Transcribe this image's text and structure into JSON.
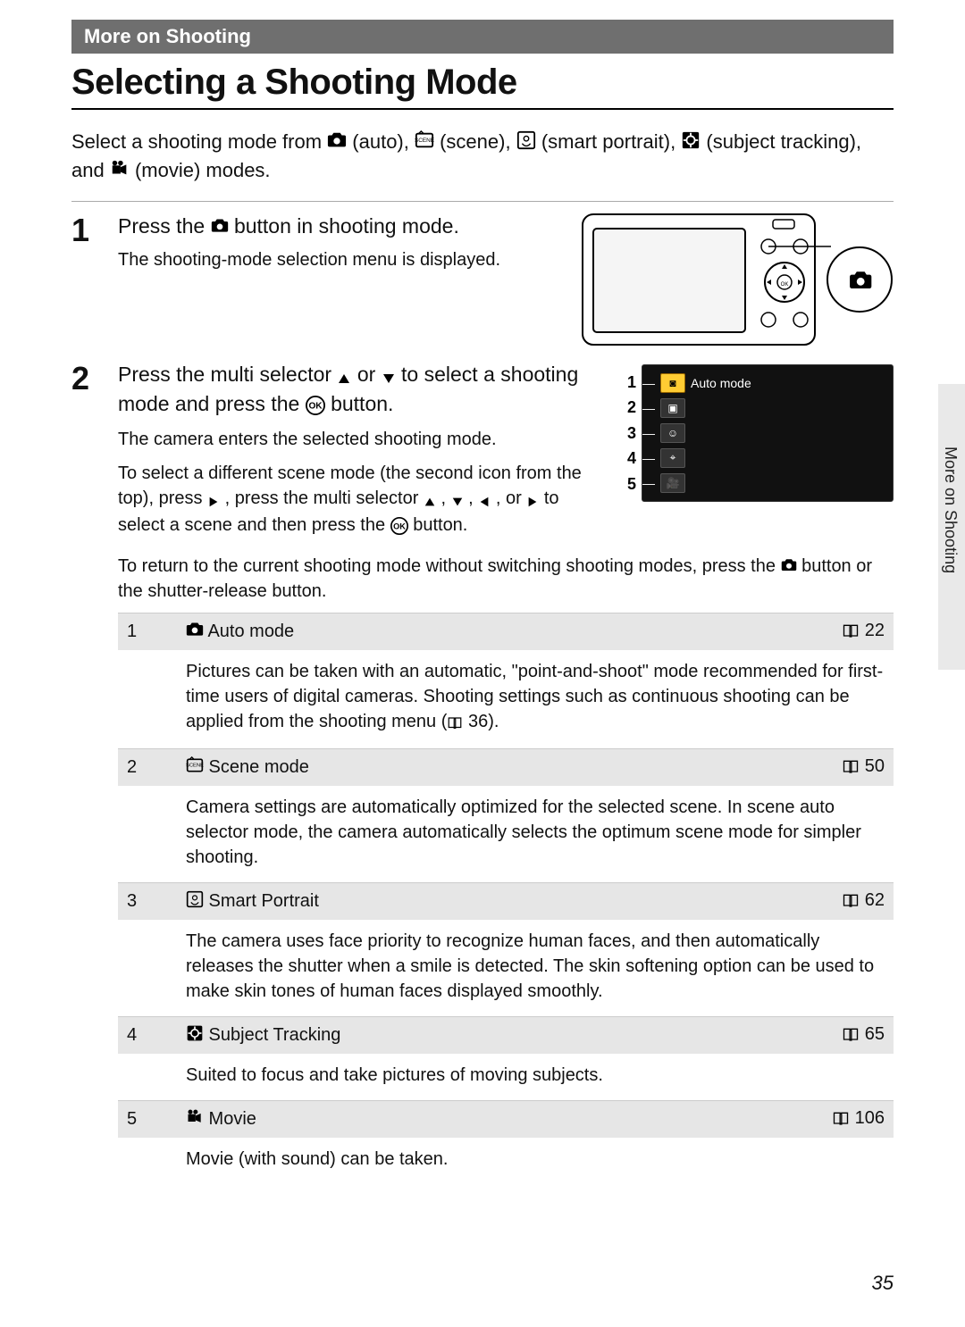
{
  "section": "More on Shooting",
  "title": "Selecting a Shooting Mode",
  "intro": {
    "a": "Select a shooting mode from ",
    "auto": " (auto), ",
    "scene": " (scene), ",
    "smart": " (smart portrait), ",
    "subject": " (subject tracking), and ",
    "movie": " (movie) modes."
  },
  "step1": {
    "num": "1",
    "title_a": "Press the ",
    "title_b": " button in shooting mode.",
    "desc": "The shooting-mode selection menu is displayed."
  },
  "step2": {
    "num": "2",
    "title_a": "Press the multi selector ",
    "title_b": " or ",
    "title_c": " to select a shooting mode and press the ",
    "title_d": " button.",
    "p1": "The camera enters the selected shooting mode.",
    "p2_a": "To select a different scene mode (the second icon from the top), press ",
    "p2_b": ", press the multi selector ",
    "p2_c": ", ",
    "p2_d": ", ",
    "p2_e": ", or ",
    "p2_f": " to select a scene and then press the ",
    "p2_g": " button.",
    "p3_a": "To return to the current shooting mode without switching shooting modes, press the ",
    "p3_b": " button or the shutter-release button."
  },
  "screen": {
    "row_nums": [
      "1",
      "2",
      "3",
      "4",
      "5"
    ],
    "selected_label": "Auto mode"
  },
  "modes": [
    {
      "n": "1",
      "name": "Auto mode",
      "page": "22",
      "desc_a": "Pictures can be taken with an automatic, \"point-and-shoot\" mode recommended for first-time users of digital cameras. Shooting settings such as continuous shooting can be applied from the shooting menu (",
      "desc_b": " 36).",
      "icon": "auto"
    },
    {
      "n": "2",
      "name": "Scene mode",
      "page": "50",
      "desc_a": "Camera settings are automatically optimized for the selected scene. In scene auto selector mode, the camera automatically selects the optimum scene mode for simpler shooting.",
      "desc_b": "",
      "icon": "scene"
    },
    {
      "n": "3",
      "name": "Smart Portrait",
      "page": "62",
      "desc_a": "The camera uses face priority to recognize human faces, and then automatically releases the shutter when a smile is detected. The skin softening option can be used to make skin tones of human faces displayed smoothly.",
      "desc_b": "",
      "icon": "smart"
    },
    {
      "n": "4",
      "name": "Subject Tracking",
      "page": "65",
      "desc_a": "Suited to focus and take pictures of moving subjects.",
      "desc_b": "",
      "icon": "subject"
    },
    {
      "n": "5",
      "name": "Movie",
      "page": "106",
      "desc_a": "Movie (with sound) can be taken.",
      "desc_b": "",
      "icon": "movie"
    }
  ],
  "side_label": "More on Shooting",
  "page_number": "35"
}
